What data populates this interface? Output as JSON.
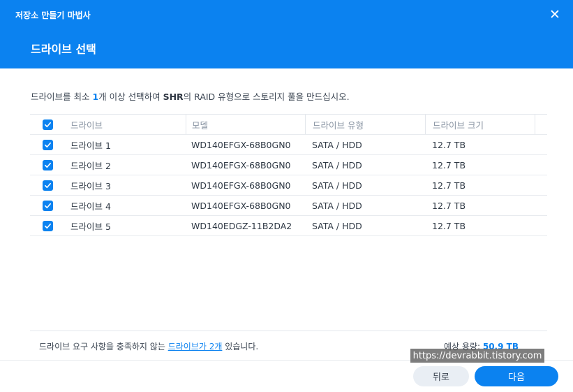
{
  "window": {
    "title": "저장소 만들기 마법사",
    "close_icon": "close-icon"
  },
  "step": {
    "title": "드라이브 선택"
  },
  "instruction": {
    "part1": "드라이브를 최소 ",
    "count": "1",
    "part2": "개 이상 선택하여 ",
    "raid_name": "SHR",
    "part3": "의 RAID 유형으로 스토리지 풀을 만드십시오."
  },
  "table": {
    "columns": [
      "드라이브",
      "모델",
      "드라이브 유형",
      "드라이브 크기"
    ],
    "select_all_checked": true,
    "rows": [
      {
        "checked": true,
        "drive": "드라이브 1",
        "model": "WD140EFGX-68B0GN0",
        "type": "SATA / HDD",
        "size": "12.7 TB"
      },
      {
        "checked": true,
        "drive": "드라이브 2",
        "model": "WD140EFGX-68B0GN0",
        "type": "SATA / HDD",
        "size": "12.7 TB"
      },
      {
        "checked": true,
        "drive": "드라이브 3",
        "model": "WD140EFGX-68B0GN0",
        "type": "SATA / HDD",
        "size": "12.7 TB"
      },
      {
        "checked": true,
        "drive": "드라이브 4",
        "model": "WD140EFGX-68B0GN0",
        "type": "SATA / HDD",
        "size": "12.7 TB"
      },
      {
        "checked": true,
        "drive": "드라이브 5",
        "model": "WD140EDGZ-11B2DA2",
        "type": "SATA / HDD",
        "size": "12.7 TB"
      }
    ]
  },
  "footer": {
    "note_prefix": "드라이브 요구 사항을 충족하지 않는 ",
    "note_link": "드라이브가 2개",
    "note_suffix": " 있습니다.",
    "capacity_label": "예상 용량: ",
    "capacity_value": "50.9 TB"
  },
  "buttons": {
    "back": "뒤로",
    "next": "다음"
  },
  "watermark": "https://devrabbit.tistory.com",
  "colors": {
    "accent": "#0b82f0",
    "text": "#3a4451",
    "muted": "#8a95a3"
  }
}
